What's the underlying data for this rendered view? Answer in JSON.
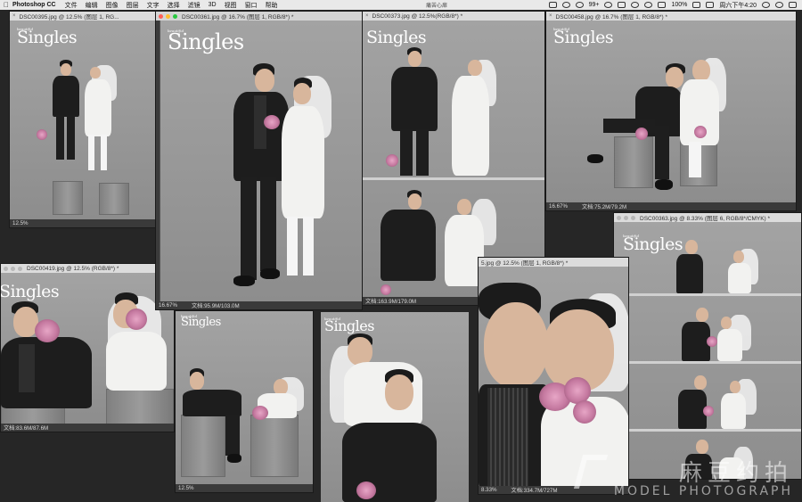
{
  "menubar": {
    "app_name": "Photoshop CC",
    "menus": [
      "文件",
      "编辑",
      "图像",
      "图层",
      "文字",
      "选择",
      "滤镜",
      "3D",
      "视图",
      "窗口",
      "帮助"
    ],
    "center_label": "痛苦心扉",
    "notif_count": "99+",
    "battery": "100%",
    "clock": "周六下午4:20"
  },
  "windows": {
    "w395": {
      "title": "DSC00395.jpg @ 12.5% (图层 1, RG...",
      "zoom": "12.5%"
    },
    "w361": {
      "title": "DSC00361.jpg @ 16.7% (图层 1, RGB/8*) *",
      "zoom": "16.67%",
      "doc": "文档:95.9M/103.0M"
    },
    "w373": {
      "title": "DSC00373.jpg @ 12.5%(RGB/8*) *",
      "doc": "文档:163.9M/179.0M"
    },
    "w458": {
      "title": "DSC00458.jpg @ 16.7% (图层 1, RGB/8*) *",
      "zoom": "16.67%",
      "doc": "文档:75.2M/79.2M"
    },
    "w363": {
      "title": "DSC00363.jpg @ 8.33% (图层 6, RGB/8*/CMYK) *"
    },
    "w419": {
      "title": "DSC00419.jpg @ 12.5% (RGB/8*) *",
      "doc": "文档:83.6M/87.6M"
    },
    "w_small": {
      "zoom": "12.5%"
    },
    "w5": {
      "title": "5.jpg @ 12.5% (图层 1, RGB/8*) *",
      "zoom": "8.33%",
      "doc": "文档:334.7M/727M"
    }
  },
  "brand_text": "Singles",
  "watermark": {
    "cn": "麻豆约拍",
    "en": "MODEL PHOTOGRAPH"
  },
  "colors": {
    "menubar": "#e9e9e9",
    "titlebar": "#dcdcdc",
    "workspace": "#262626",
    "canvas": "#9a9a9a"
  }
}
